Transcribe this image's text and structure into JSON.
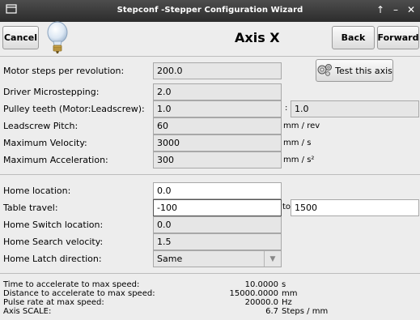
{
  "window": {
    "title": "Stepconf -Stepper Configuration Wizard"
  },
  "header": {
    "cancel_label": "Cancel",
    "page_title": "Axis X",
    "back_label": "Back",
    "forward_label": "Forward",
    "test_axis_label": "Test this axis"
  },
  "form": {
    "motor_steps": {
      "label": "Motor steps per revolution:",
      "value": "200.0"
    },
    "microstepping": {
      "label": "Driver Microstepping:",
      "value": "2.0"
    },
    "pulley": {
      "label": "Pulley teeth (Motor:Leadscrew):",
      "value_motor": "1.0",
      "separator": ":",
      "value_leadscrew": "1.0"
    },
    "leadscrew_pitch": {
      "label": "Leadscrew Pitch:",
      "value": "60",
      "unit": "mm / rev"
    },
    "max_velocity": {
      "label": "Maximum Velocity:",
      "value": "3000",
      "unit": "mm / s"
    },
    "max_accel": {
      "label": "Maximum Acceleration:",
      "value": "300",
      "unit": "mm / s²"
    },
    "home_location": {
      "label": "Home location:",
      "value": "0.0"
    },
    "table_travel": {
      "label": "Table travel:",
      "value_from": "-100",
      "to_label": "to",
      "value_to": "1500"
    },
    "home_switch": {
      "label": "Home Switch location:",
      "value": "0.0"
    },
    "home_search_vel": {
      "label": "Home Search velocity:",
      "value": "1.5"
    },
    "home_latch": {
      "label": "Home Latch direction:",
      "value": "Same"
    }
  },
  "stats": {
    "time_label": "Time to accelerate to max speed:",
    "time_value": "10.0000",
    "time_unit": "s",
    "distance_label": "Distance to accelerate to max speed:",
    "distance_value": "15000.0000",
    "distance_unit": "mm",
    "pulse_label": "Pulse rate at max speed:",
    "pulse_value": "20000.0",
    "pulse_unit": "Hz",
    "scale_label": "Axis SCALE:",
    "scale_value": "6.7",
    "scale_unit": "Steps / mm"
  }
}
